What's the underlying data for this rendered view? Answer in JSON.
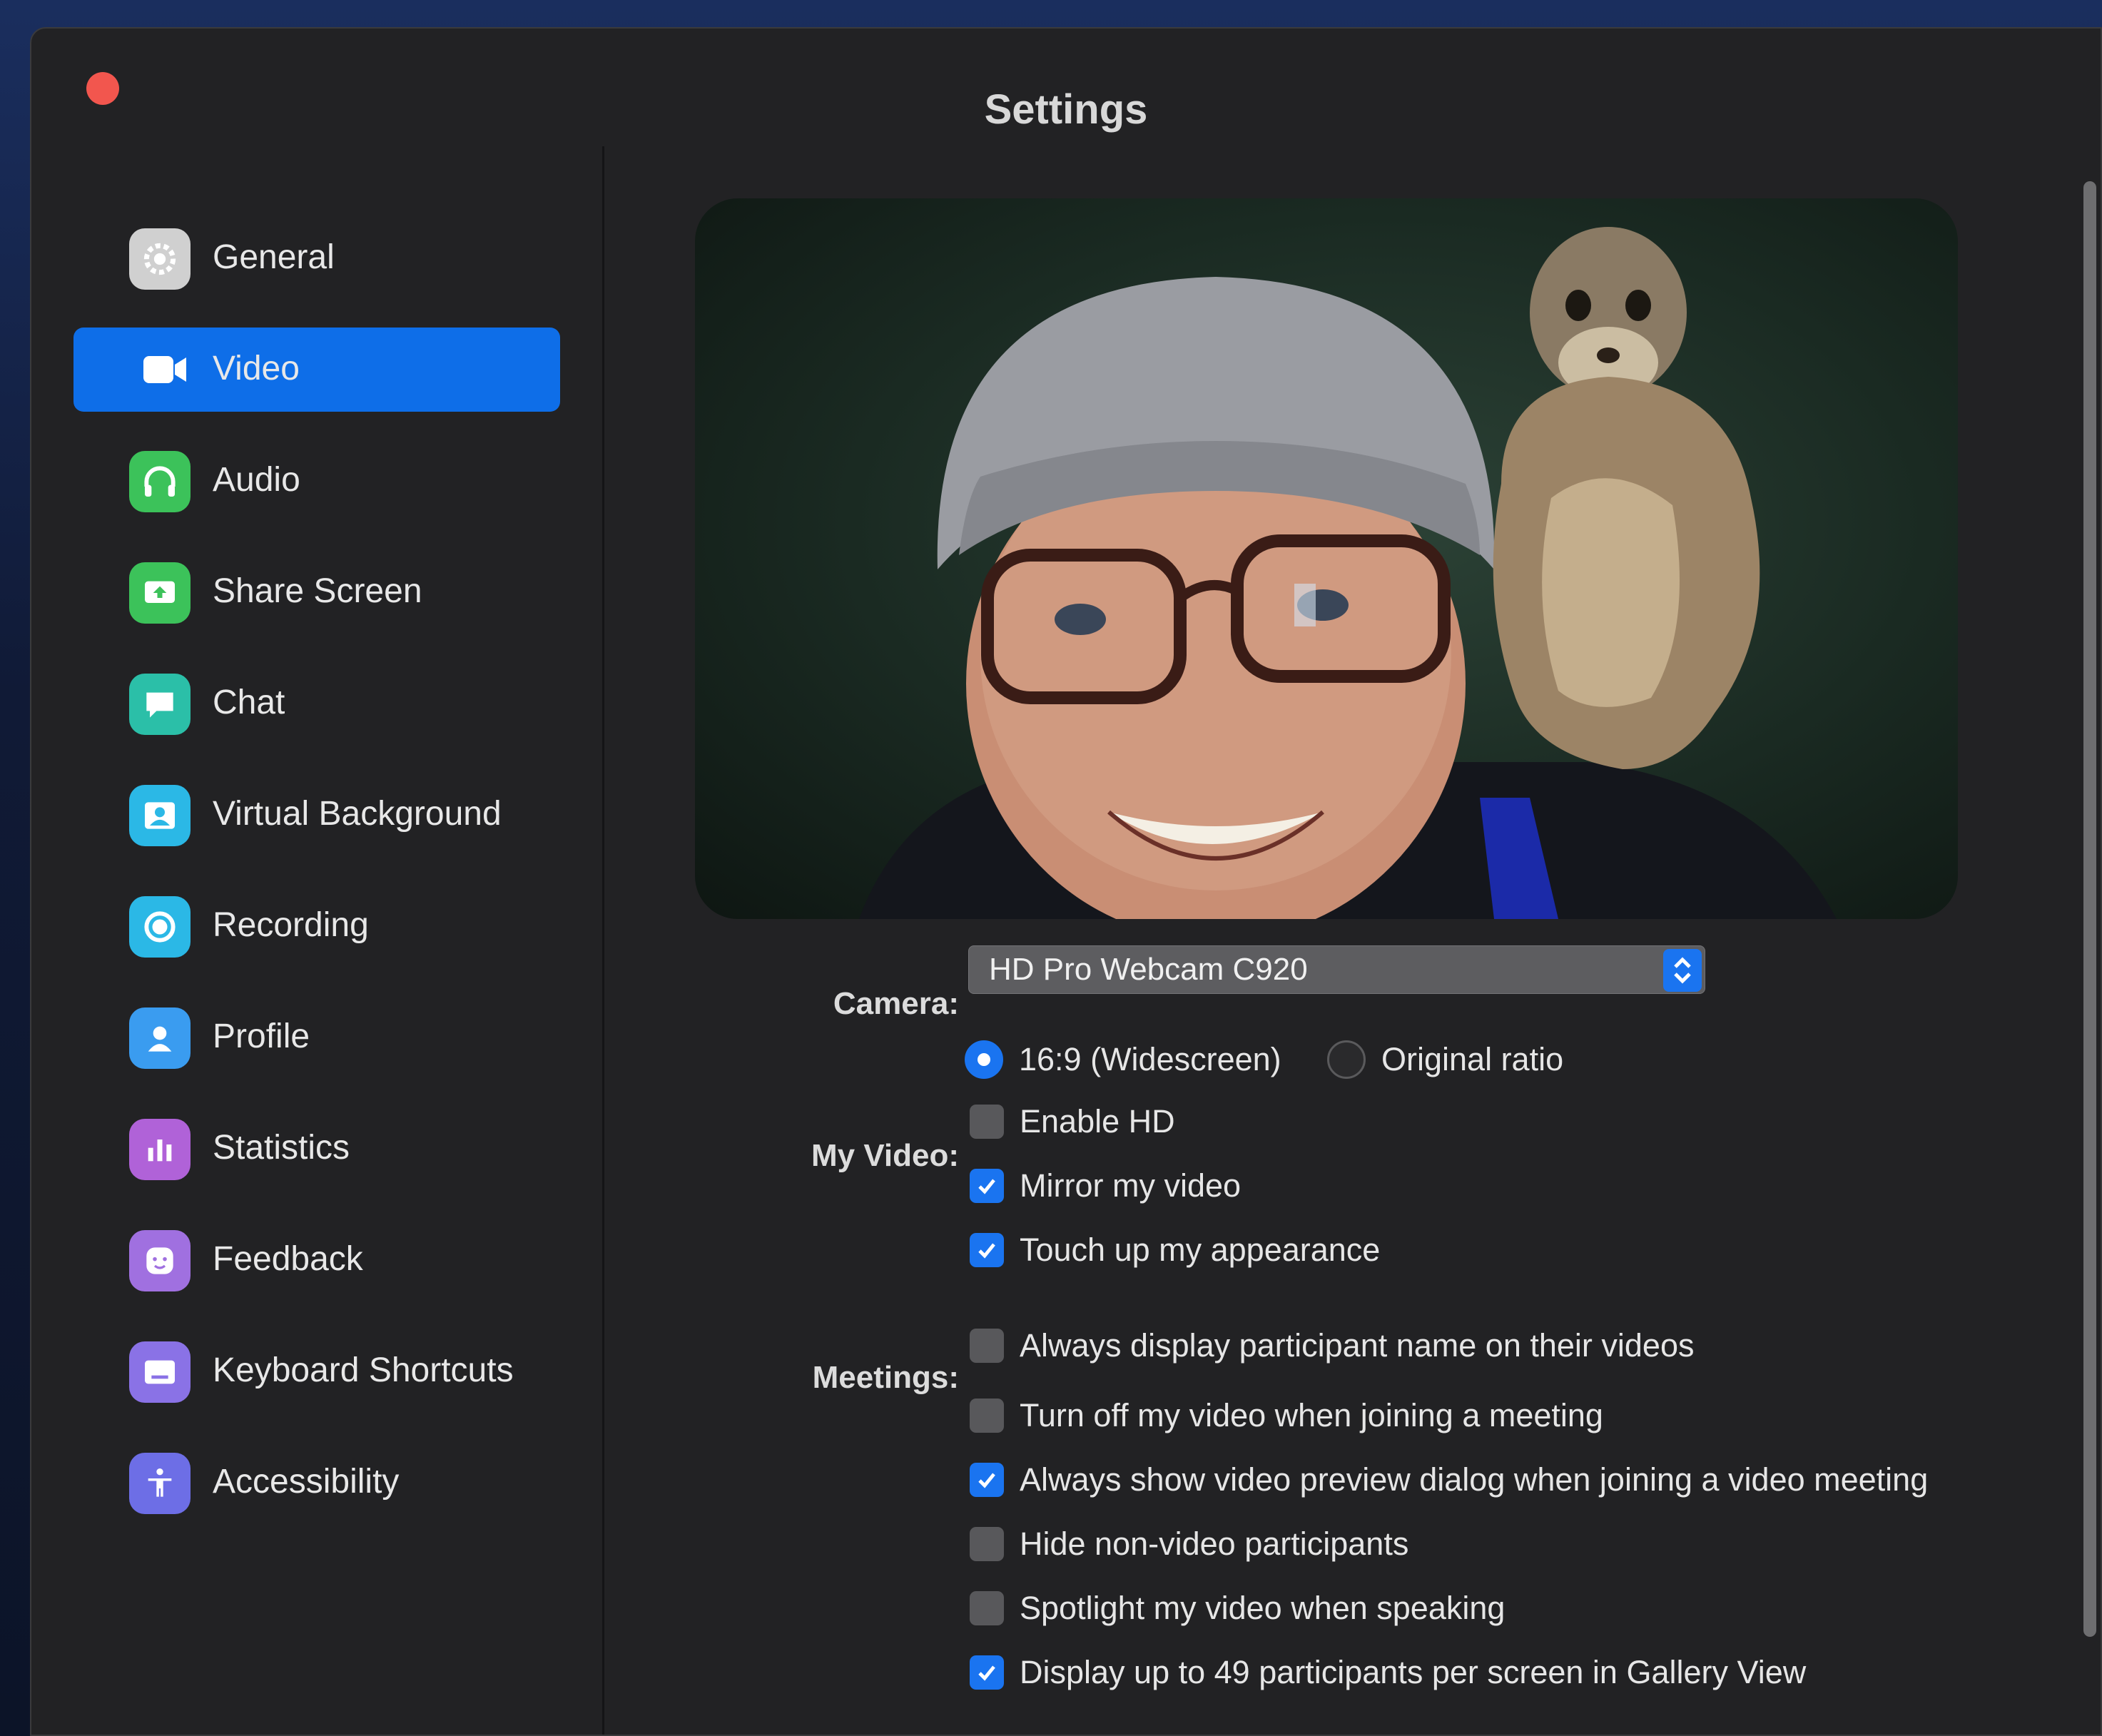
{
  "window": {
    "title": "Settings"
  },
  "sidebar": {
    "items": [
      {
        "label": "General",
        "icon": "gear-icon",
        "color": "#d8d8d8",
        "active": false
      },
      {
        "label": "Video",
        "icon": "video-camera-icon",
        "color": "#ffffff",
        "active": true
      },
      {
        "label": "Audio",
        "icon": "headphones-icon",
        "color": "#3cc25a",
        "active": false
      },
      {
        "label": "Share Screen",
        "icon": "share-screen-icon",
        "color": "#3cc25a",
        "active": false
      },
      {
        "label": "Chat",
        "icon": "chat-bubble-icon",
        "color": "#2bbfa8",
        "active": false
      },
      {
        "label": "Virtual Background",
        "icon": "virtual-background-icon",
        "color": "#2bb8e6",
        "active": false
      },
      {
        "label": "Recording",
        "icon": "record-icon",
        "color": "#2bb8e6",
        "active": false
      },
      {
        "label": "Profile",
        "icon": "profile-icon",
        "color": "#3a9cf0",
        "active": false
      },
      {
        "label": "Statistics",
        "icon": "bar-chart-icon",
        "color": "#b062d8",
        "active": false
      },
      {
        "label": "Feedback",
        "icon": "smiley-icon",
        "color": "#a070e0",
        "active": false
      },
      {
        "label": "Keyboard Shortcuts",
        "icon": "keyboard-icon",
        "color": "#8a72e6",
        "active": false
      },
      {
        "label": "Accessibility",
        "icon": "accessibility-icon",
        "color": "#6d6ee6",
        "active": false
      }
    ]
  },
  "camera": {
    "label": "Camera:",
    "value": "HD Pro Webcam C920"
  },
  "my_video": {
    "label": "My Video:",
    "ratio_options": [
      {
        "label": "16:9 (Widescreen)",
        "selected": true
      },
      {
        "label": "Original ratio",
        "selected": false
      }
    ],
    "options": [
      {
        "label": "Enable HD",
        "checked": false
      },
      {
        "label": "Mirror my video",
        "checked": true
      },
      {
        "label": "Touch up my appearance",
        "checked": true
      }
    ]
  },
  "meetings": {
    "label": "Meetings:",
    "options": [
      {
        "label": "Always display participant name on their videos",
        "checked": false
      },
      {
        "label": "Turn off my video when joining a meeting",
        "checked": false
      },
      {
        "label": "Always show video preview dialog when joining a video meeting",
        "checked": true
      },
      {
        "label": "Hide non-video participants",
        "checked": false
      },
      {
        "label": "Spotlight my video when speaking",
        "checked": false
      },
      {
        "label": "Display up to 49 participants per screen in Gallery View",
        "checked": true
      }
    ]
  },
  "colors": {
    "accent": "#1a74f0",
    "window_bg": "#222224",
    "close": "#f2564e"
  }
}
